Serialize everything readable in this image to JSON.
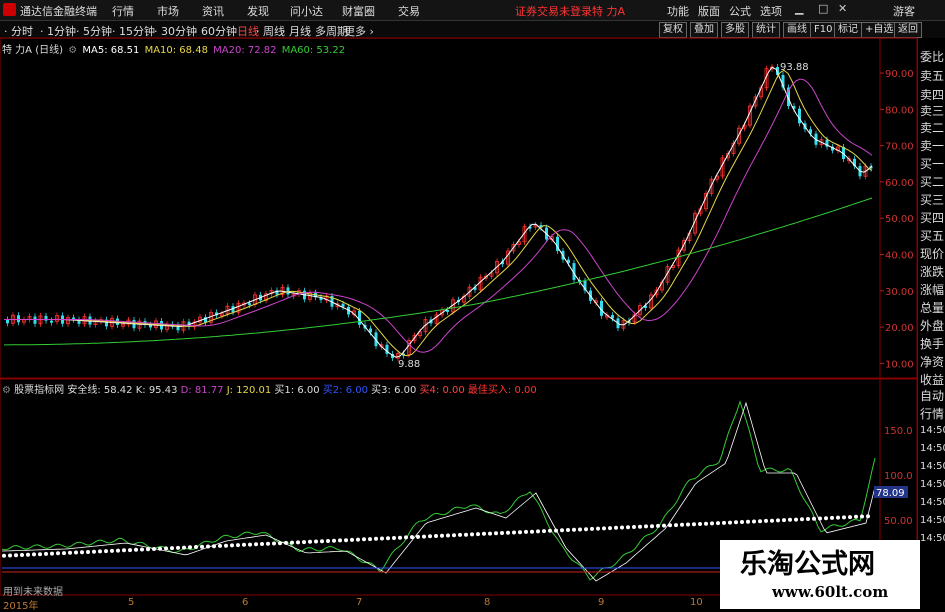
{
  "titlebar": {
    "app_title": "通达信金融终端",
    "menus": [
      "行情",
      "市场",
      "资讯",
      "发现",
      "问小达",
      "财富圈",
      "交易"
    ],
    "status": "证券交易未登录",
    "stock_name": "特 力A",
    "right_menus": [
      "功能",
      "版面",
      "公式",
      "选项"
    ],
    "guest": "游客"
  },
  "toolbar": {
    "periods": [
      "分时",
      "1分钟",
      "5分钟",
      "15分钟",
      "30分钟",
      "60分钟",
      "日线",
      "周线",
      "月线",
      "多周期",
      "更多"
    ],
    "active_period": "日线",
    "right_buttons": [
      "复权",
      "叠加",
      "多股",
      "统计",
      "画线",
      "F10",
      "标记",
      "+自选",
      "返回"
    ]
  },
  "ma_line": {
    "name": "特 力A (日线)",
    "ma5": "MA5: 68.51",
    "ma10": "MA10: 68.48",
    "ma20": "MA20: 72.82",
    "ma60": "MA60: 53.22"
  },
  "price_axis": [
    "90.00",
    "80.00",
    "70.00",
    "60.00",
    "50.00",
    "40.00",
    "30.00",
    "20.00",
    "10.00"
  ],
  "price_marks": {
    "high": "93.88",
    "low": "9.88"
  },
  "indicator_line": {
    "name": "股票指标网",
    "safe": "安全线: 58.42",
    "k": "K: 95.43",
    "d": "D: 81.77",
    "j": "J: 120.01",
    "b1": "买1: 6.00",
    "b2": "买2: 6.00",
    "b3": "买3: 6.00",
    "b4": "买4: 0.00",
    "best": "最佳买入: 0.00"
  },
  "ind_axis": [
    "150.0",
    "100.0",
    "50.00"
  ],
  "ind_value": "78.09",
  "sidebar": [
    "委比",
    "卖五",
    "卖四",
    "卖三",
    "卖二",
    "卖一",
    "买一",
    "买二",
    "买三",
    "买四",
    "买五",
    "现价",
    "涨跌",
    "涨幅",
    "总量",
    "外盘",
    "换手",
    "净资",
    "收益",
    "自动",
    "行情",
    "14:50",
    "14:50",
    "14:50",
    "14:50",
    "14:50",
    "14:50",
    "14:50"
  ],
  "dates": [
    "2015年",
    "5",
    "6",
    "7",
    "8",
    "9",
    "10"
  ],
  "no_future": "用到未来数据",
  "watermark": {
    "cn": "乐淘公式网",
    "url": "www.60lt.com"
  },
  "colors": {
    "ma5": "#ffffff",
    "ma10": "#e8d84a",
    "ma20": "#cc44cc",
    "ma60": "#33cc33",
    "up": "#ff3333",
    "down": "#33ddee"
  }
}
